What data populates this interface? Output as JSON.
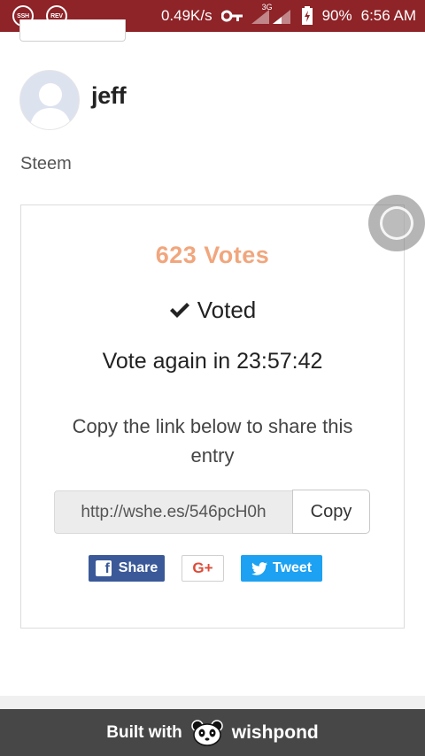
{
  "status_bar": {
    "left_icons": [
      "SSH",
      "REV"
    ],
    "net_speed": "0.49K/s",
    "network_type": "3G",
    "battery": "90%",
    "time": "6:56 AM",
    "icons": [
      "key-icon",
      "signal-icon",
      "battery-charging-icon"
    ]
  },
  "profile": {
    "username": "jeff",
    "category": "Steem"
  },
  "vote_card": {
    "votes": "623 Votes",
    "voted_label": "Voted",
    "vote_again": "Vote again in 23:57:42",
    "copy_instructions": "Copy the link below to share this entry",
    "share_link": "http://wshe.es/546pcH0h",
    "copy_button": "Copy",
    "accent_color": "#f1a67d"
  },
  "share": {
    "facebook_label": "Share",
    "google_label": "G+",
    "twitter_label": "Tweet",
    "facebook_color": "#3b5998",
    "twitter_color": "#1da1f2"
  },
  "footer": {
    "built_with": "Built with",
    "brand": "wishpond"
  },
  "colors": {
    "status_bar": "#8e2328",
    "footer": "#474747"
  }
}
